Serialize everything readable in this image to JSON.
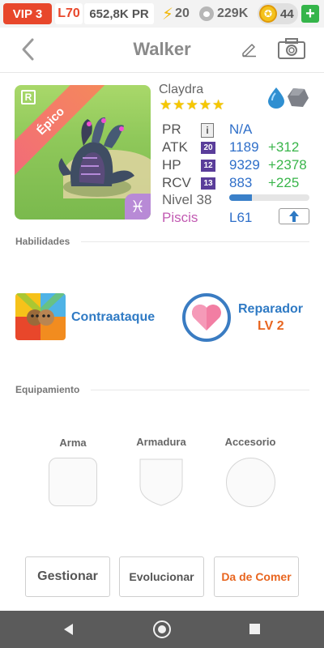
{
  "topbar": {
    "vip": "VIP 3",
    "level": "L70",
    "power": "652,8K PR",
    "energy": "20",
    "food": "229K",
    "coins": "44",
    "add": "+"
  },
  "header": {
    "title": "Walker"
  },
  "creature": {
    "name": "Claydra",
    "rarity_label": "Épico",
    "rarity_letter": "R",
    "stars": 5,
    "zodiac_symbol": "♓",
    "elements": [
      "water",
      "rock"
    ]
  },
  "stats": {
    "pr_label": "PR",
    "pr_info": "i",
    "pr_value": "N/A",
    "atk_label": "ATK",
    "atk_rank": "20",
    "atk_value": "1189",
    "atk_bonus": "+312",
    "hp_label": "HP",
    "hp_rank": "12",
    "hp_value": "9329",
    "hp_bonus": "+2378",
    "rcv_label": "RCV",
    "rcv_rank": "13",
    "rcv_value": "883",
    "rcv_bonus": "+225",
    "level_label": "Nivel 38",
    "level_progress": 0.28,
    "zodiac": "Piscis",
    "zodiac_level": "L61"
  },
  "abilities": {
    "section_title": "Habilidades",
    "skill1": "Contraataque",
    "skill2": "Reparador",
    "skill2_level": "LV 2"
  },
  "equipment": {
    "section_title": "Equipamiento",
    "weapon": "Arma",
    "armor": "Armadura",
    "accessory": "Accesorio"
  },
  "actions": {
    "manage": "Gestionar",
    "evolve": "Evolucionar",
    "feed": "Da de Comer"
  },
  "colors": {
    "accent_blue": "#2f7ac4",
    "bonus_green": "#39b54a",
    "vip_red": "#e8472b",
    "feed_orange": "#e8651f",
    "zodiac_pink": "#c25ab2"
  }
}
